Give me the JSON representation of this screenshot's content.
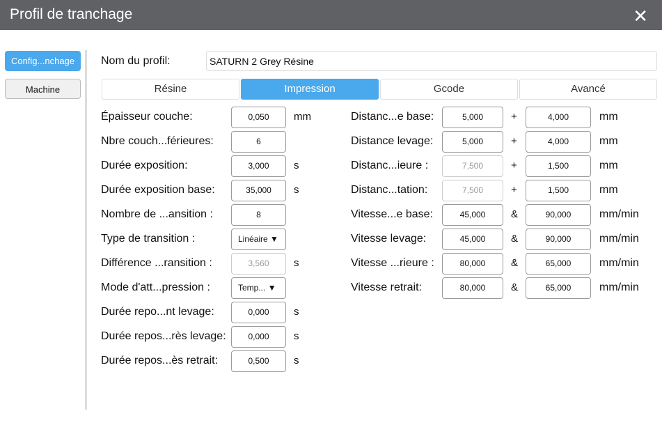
{
  "window": {
    "title": "Profil de tranchage",
    "close_icon": "close-icon"
  },
  "sidebar": {
    "items": [
      {
        "label": "Config...nchage",
        "active": true
      },
      {
        "label": "Machine",
        "active": false
      }
    ]
  },
  "profile": {
    "label": "Nom du profil:",
    "value": "SATURN 2 Grey Résine"
  },
  "tabs": [
    {
      "label": "Résine"
    },
    {
      "label": "Impression",
      "active": true
    },
    {
      "label": "Gcode"
    },
    {
      "label": "Avancé"
    }
  ],
  "left_fields": [
    {
      "label": "Épaisseur couche:",
      "value": "0,050",
      "unit": "mm"
    },
    {
      "label": "Nbre couch...férieures:",
      "value": "6",
      "unit": ""
    },
    {
      "label": "Durée exposition:",
      "value": "3,000",
      "unit": "s"
    },
    {
      "label": "Durée exposition base:",
      "value": "35,000",
      "unit": "s"
    },
    {
      "label": "Nombre de ...ansition :",
      "value": "8",
      "unit": ""
    },
    {
      "label": "Type de transition :",
      "value": "Linéaire",
      "unit": "",
      "select": true
    },
    {
      "label": "Différence ...ransition :",
      "value": "3,560",
      "unit": "s",
      "disabled": true
    },
    {
      "label": "Mode d'att...pression :",
      "value": "Temp...",
      "unit": "",
      "select": true
    },
    {
      "label": "Durée repo...nt levage:",
      "value": "0,000",
      "unit": "s"
    },
    {
      "label": "Durée repos...rès levage:",
      "value": "0,000",
      "unit": "s"
    },
    {
      "label": "Durée repos...ès retrait:",
      "value": "0,500",
      "unit": "s"
    }
  ],
  "right_fields": [
    {
      "label": "Distanc...e base:",
      "value1": "5,000",
      "sym": "+",
      "value2": "4,000",
      "unit": "mm"
    },
    {
      "label": "Distance levage:",
      "value1": "5,000",
      "sym": "+",
      "value2": "4,000",
      "unit": "mm"
    },
    {
      "label": "Distanc...ieure :",
      "value1": "7,500",
      "sym": "+",
      "value2": "1,500",
      "unit": "mm",
      "disabled1": true
    },
    {
      "label": "Distanc...tation:",
      "value1": "7,500",
      "sym": "+",
      "value2": "1,500",
      "unit": "mm",
      "disabled1": true
    },
    {
      "label": "Vitesse...e base:",
      "value1": "45,000",
      "sym": "&",
      "value2": "90,000",
      "unit": "mm/min"
    },
    {
      "label": "Vitesse levage:",
      "value1": "45,000",
      "sym": "&",
      "value2": "90,000",
      "unit": "mm/min"
    },
    {
      "label": "Vitesse ...rieure :",
      "value1": "80,000",
      "sym": "&",
      "value2": "65,000",
      "unit": "mm/min"
    },
    {
      "label": "Vitesse retrait:",
      "value1": "80,000",
      "sym": "&",
      "value2": "65,000",
      "unit": "mm/min"
    }
  ]
}
